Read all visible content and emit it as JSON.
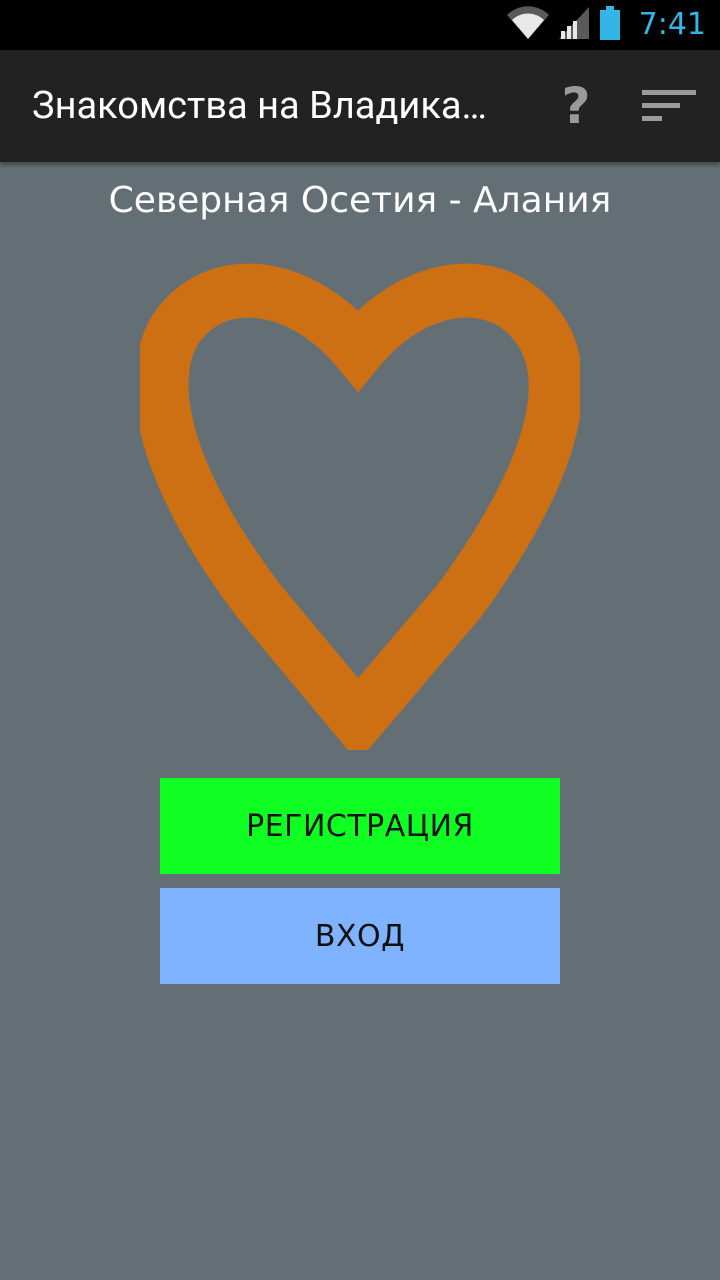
{
  "status_bar": {
    "time": "7:41"
  },
  "action_bar": {
    "title": "Знакомства на Владикавказ",
    "help_label": "?",
    "icons": {
      "help": "help-icon",
      "sort": "sort-icon"
    }
  },
  "main": {
    "region": "Северная Осетия - Алания",
    "register_label": "РЕГИСТРАЦИЯ",
    "login_label": "ВХОД"
  },
  "colors": {
    "background": "#636f74",
    "heart": "#cc7013",
    "register": "#0fff22",
    "login": "#7fb3ff",
    "time": "#33b5e5"
  }
}
